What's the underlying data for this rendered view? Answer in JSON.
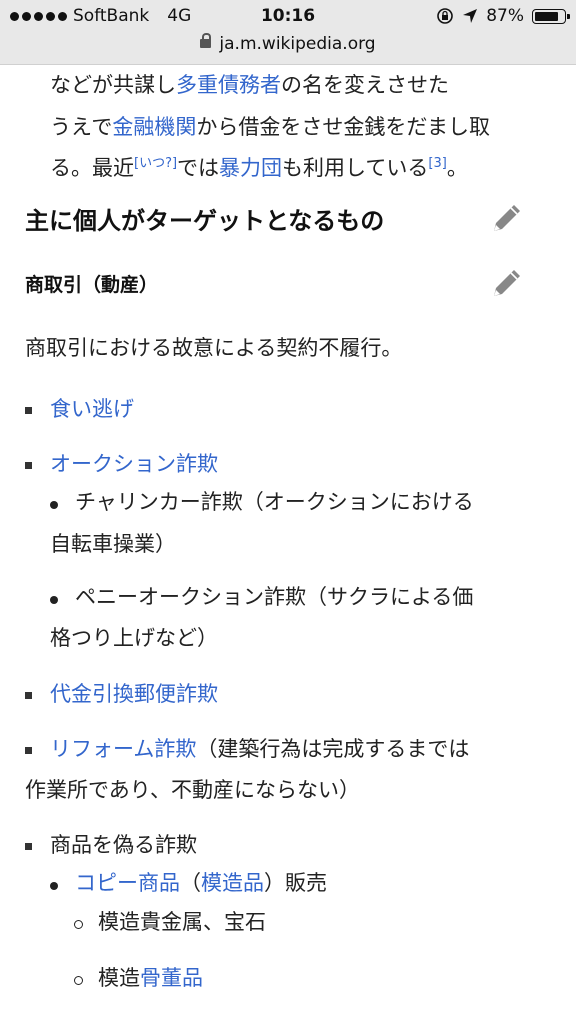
{
  "status_bar": {
    "carrier": "SoftBank",
    "network": "4G",
    "time": "10:16",
    "battery": "87%",
    "battery_level": 0.87,
    "url": "ja.m.wikipedia.org"
  },
  "article": {
    "intro": {
      "t1": "などが共謀し",
      "l1": "多重債務者",
      "t2": "の名を変えさせたうえで",
      "l2": "金融機関",
      "t3": "から借金をさせ金銭をだまし取る。最近",
      "sup1": "[いつ?]",
      "t4": "では",
      "l3": "暴力団",
      "t5": "も利用している",
      "sup2": "[3]",
      "t6": "。"
    },
    "h2": "主に個人がターゲットとなるもの",
    "h3": "商取引（動産）",
    "desc": "商取引における故意による契約不履行。",
    "items": {
      "kuinige": "食い逃げ",
      "auction": "オークション詐欺",
      "charinka": "チャリンカー詐欺（オークションにおける",
      "charinka2": "自転車操業）",
      "penny": "ペニーオークション詐欺（サクラによる価",
      "penny2": "格つり上げなど）",
      "daikin": "代金引換郵便詐欺",
      "reform_link": "リフォーム詐欺",
      "reform_text": "（建築行為は完成するまでは",
      "reform_text2": "作業所であり、不動産にならない）",
      "shohin": "商品を偽る詐欺",
      "copy_link": "コピー商品",
      "copy_paren_open": "（",
      "mozo_link": "模造品",
      "copy_paren_close": "）販売",
      "kikinzoku": "模造貴金属、宝石",
      "kotto_text": "模造",
      "kotto_link": "骨董品"
    }
  }
}
